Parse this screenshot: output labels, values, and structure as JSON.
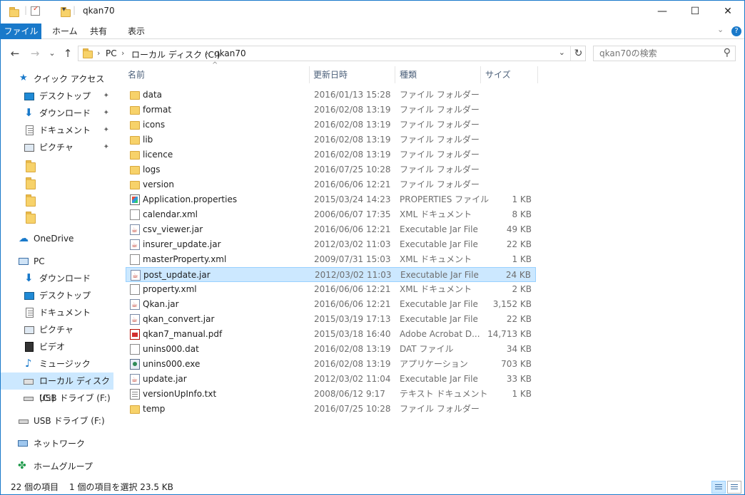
{
  "window": {
    "title": "qkan70",
    "controls": {
      "minimize": "—",
      "maximize": "☐",
      "close": "✕"
    }
  },
  "ribbon": {
    "tabs": [
      "ファイル",
      "ホーム",
      "共有",
      "表示"
    ],
    "collapse_icon": "⌄",
    "help_icon": "?"
  },
  "address": {
    "back": "←",
    "forward": "→",
    "recent": "⌄",
    "up": "↑",
    "segments": [
      "PC",
      "ローカル ディスク (C:)",
      "qkan70"
    ],
    "refresh": "↻"
  },
  "search": {
    "placeholder": "qkan70の検索",
    "icon": "⚲"
  },
  "nav": {
    "quick_access": "クイック アクセス",
    "quick_items": [
      "デスクトップ",
      "ダウンロード",
      "ドキュメント",
      "ピクチャ"
    ],
    "pin_icon": "📌",
    "onedrive": "OneDrive",
    "pc": "PC",
    "pc_items": [
      "ダウンロード",
      "デスクトップ",
      "ドキュメント",
      "ピクチャ",
      "ビデオ",
      "ミュージック",
      "ローカル ディスク (C:)",
      "USB ドライブ (F:)"
    ],
    "usb": "USB ドライブ (F:)",
    "network": "ネットワーク",
    "homegroup": "ホームグループ"
  },
  "columns": {
    "name": "名前",
    "date": "更新日時",
    "type": "種類",
    "size": "サイズ",
    "sort_indicator": "^"
  },
  "files": [
    {
      "name": "data",
      "date": "2016/01/13 15:28",
      "type": "ファイル フォルダー",
      "size": "",
      "icon": "folder"
    },
    {
      "name": "format",
      "date": "2016/02/08 13:19",
      "type": "ファイル フォルダー",
      "size": "",
      "icon": "folder"
    },
    {
      "name": "icons",
      "date": "2016/02/08 13:19",
      "type": "ファイル フォルダー",
      "size": "",
      "icon": "folder"
    },
    {
      "name": "lib",
      "date": "2016/02/08 13:19",
      "type": "ファイル フォルダー",
      "size": "",
      "icon": "folder"
    },
    {
      "name": "licence",
      "date": "2016/02/08 13:19",
      "type": "ファイル フォルダー",
      "size": "",
      "icon": "folder"
    },
    {
      "name": "logs",
      "date": "2016/07/25 10:28",
      "type": "ファイル フォルダー",
      "size": "",
      "icon": "folder"
    },
    {
      "name": "version",
      "date": "2016/06/06 12:21",
      "type": "ファイル フォルダー",
      "size": "",
      "icon": "folder"
    },
    {
      "name": "Application.properties",
      "date": "2015/03/24 14:23",
      "type": "PROPERTIES ファイル",
      "size": "1 KB",
      "icon": "prop"
    },
    {
      "name": "calendar.xml",
      "date": "2006/06/07 17:35",
      "type": "XML ドキュメント",
      "size": "8 KB",
      "icon": "doc"
    },
    {
      "name": "csv_viewer.jar",
      "date": "2016/06/06 12:21",
      "type": "Executable Jar File",
      "size": "49 KB",
      "icon": "jar"
    },
    {
      "name": "insurer_update.jar",
      "date": "2012/03/02 11:03",
      "type": "Executable Jar File",
      "size": "22 KB",
      "icon": "jar"
    },
    {
      "name": "masterProperty.xml",
      "date": "2009/07/31 15:03",
      "type": "XML ドキュメント",
      "size": "1 KB",
      "icon": "doc"
    },
    {
      "name": "post_update.jar",
      "date": "2012/03/02 11:03",
      "type": "Executable Jar File",
      "size": "24 KB",
      "icon": "jar",
      "selected": true
    },
    {
      "name": "property.xml",
      "date": "2016/06/06 12:21",
      "type": "XML ドキュメント",
      "size": "2 KB",
      "icon": "doc"
    },
    {
      "name": "Qkan.jar",
      "date": "2016/06/06 12:21",
      "type": "Executable Jar File",
      "size": "3,152 KB",
      "icon": "jar"
    },
    {
      "name": "qkan_convert.jar",
      "date": "2015/03/19 17:13",
      "type": "Executable Jar File",
      "size": "22 KB",
      "icon": "jar"
    },
    {
      "name": "qkan7_manual.pdf",
      "date": "2015/03/18 16:40",
      "type": "Adobe Acrobat D...",
      "size": "14,713 KB",
      "icon": "pdf"
    },
    {
      "name": "unins000.dat",
      "date": "2016/02/08 13:19",
      "type": "DAT ファイル",
      "size": "34 KB",
      "icon": "doc"
    },
    {
      "name": "unins000.exe",
      "date": "2016/02/08 13:19",
      "type": "アプリケーション",
      "size": "703 KB",
      "icon": "exe"
    },
    {
      "name": "update.jar",
      "date": "2012/03/02 11:04",
      "type": "Executable Jar File",
      "size": "33 KB",
      "icon": "jar"
    },
    {
      "name": "versionUpInfo.txt",
      "date": "2008/06/12 9:17",
      "type": "テキスト ドキュメント",
      "size": "1 KB",
      "icon": "txt"
    },
    {
      "name": "temp",
      "date": "2016/07/25 10:28",
      "type": "ファイル フォルダー",
      "size": "",
      "icon": "folder"
    }
  ],
  "status": {
    "count": "22 個の項目",
    "selection": "1 個の項目を選択  23.5 KB"
  },
  "colors": {
    "accent": "#1979ca",
    "selection": "#cce8ff",
    "selection_border": "#99d1ff"
  }
}
